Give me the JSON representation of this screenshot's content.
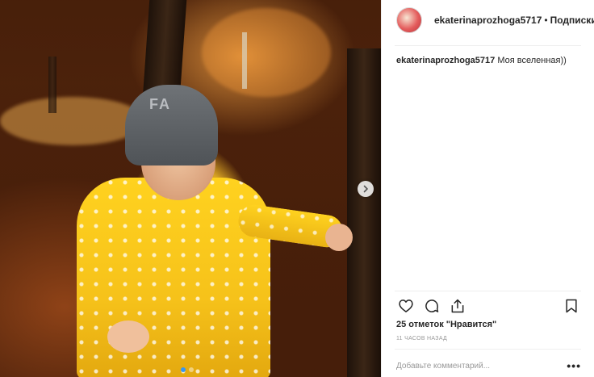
{
  "post": {
    "image": {
      "hat_text": "FA",
      "carousel_dots": 2,
      "active_dot": 1
    },
    "header": {
      "username": "ekaterinaprozhoga5717",
      "separator": "•",
      "follow_label": "Подписки"
    },
    "caption": {
      "username": "ekaterinaprozhoga5717",
      "text": "Моя вселенная))"
    },
    "likes": "25 отметок \"Нравится\"",
    "timestamp": "11 часов назад",
    "comment": {
      "placeholder": "Добавьте комментарий..."
    },
    "more_label": "•••",
    "icons": {
      "like": "heart-icon",
      "comment": "comment-icon",
      "share": "share-icon",
      "save": "bookmark-icon",
      "next": "chevron-right-icon"
    },
    "colors": {
      "accent": "#3897f0",
      "text": "#262626",
      "muted": "#999999"
    }
  }
}
